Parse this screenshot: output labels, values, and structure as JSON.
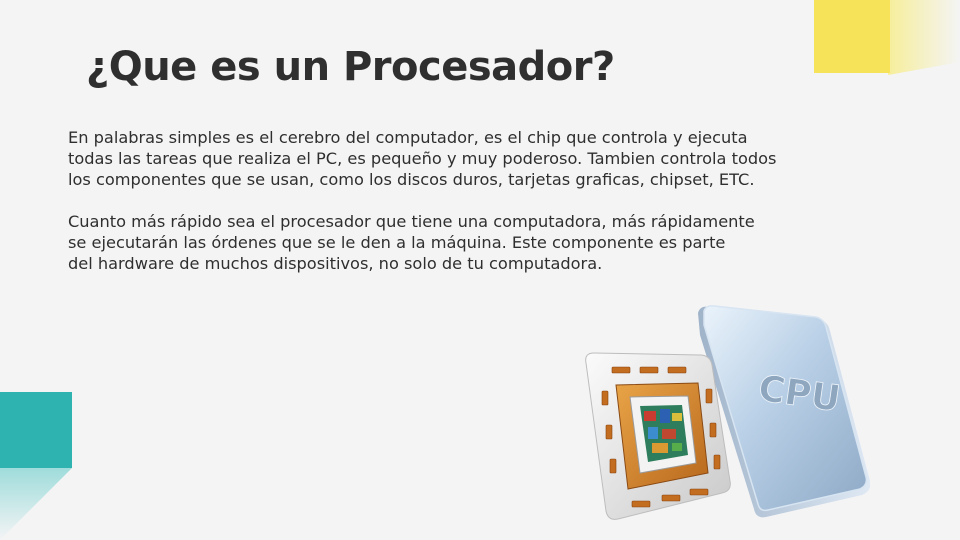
{
  "slide": {
    "title": "¿Que es un Procesador?",
    "paragraphs": [
      {
        "lines": [
          "En palabras simples es el cerebro del computador, es el chip que controla y ejecuta",
          "todas las tareas que realiza el PC, es pequeño y muy poderoso. Tambien controla todos",
          "los componentes que se usan, como los discos duros, tarjetas graficas, chipset, ETC."
        ]
      },
      {
        "lines": [
          "Cuanto más rápido sea el procesador que tiene una computadora, más rápidamente",
          "se ejecutarán las órdenes que se le den a la máquina. Este componente es parte",
          "del hardware de muchos dispositivos, no solo de tu computadora."
        ]
      }
    ]
  },
  "illustration": {
    "cpu_label": "CPU"
  },
  "colors": {
    "background": "#f4f4f5",
    "accent_yellow": "#f7e35a",
    "accent_teal": "#2fb3b0",
    "text": "#2f2f2f"
  }
}
